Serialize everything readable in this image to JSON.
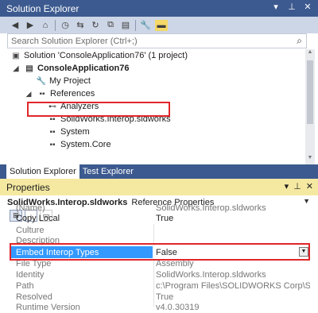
{
  "solution_explorer": {
    "title": "Solution Explorer",
    "search_placeholder": "Search Solution Explorer (Ctrl+;)",
    "tree": [
      {
        "label": "Solution 'ConsoleApplication76' (1 project)",
        "icon": "solution-icon",
        "bold": false
      },
      {
        "label": "ConsoleApplication76",
        "icon": "csharp-project-icon",
        "bold": true
      },
      {
        "label": "My Project",
        "icon": "wrench-icon",
        "bold": false
      },
      {
        "label": "References",
        "icon": "references-icon",
        "bold": false
      },
      {
        "label": "Analyzers",
        "icon": "analyzer-icon",
        "bold": false
      },
      {
        "label": "SolidWorks.Interop.sldworks",
        "icon": "reference-icon",
        "bold": false
      },
      {
        "label": "System",
        "icon": "reference-icon",
        "bold": false
      },
      {
        "label": "System.Core",
        "icon": "reference-icon",
        "bold": false
      }
    ],
    "tabs": [
      "Solution Explorer",
      "Test Explorer"
    ]
  },
  "properties": {
    "title": "Properties",
    "object_name": "SolidWorks.Interop.sldworks",
    "object_type": "Reference Properties",
    "rows": [
      {
        "name": "(Name)",
        "value": "SolidWorks.Interop.sldworks",
        "dark": false
      },
      {
        "name": "Copy Local",
        "value": "True",
        "dark": true
      },
      {
        "name": "Culture",
        "value": "",
        "dark": false
      },
      {
        "name": "Description",
        "value": "",
        "dark": false
      },
      {
        "name": "Embed Interop Types",
        "value": "False",
        "dark": true,
        "selected": true
      },
      {
        "name": "File Type",
        "value": "Assembly",
        "dark": false
      },
      {
        "name": "Identity",
        "value": "SolidWorks.Interop.sldworks",
        "dark": false
      },
      {
        "name": "Path",
        "value": "c:\\Program Files\\SOLIDWORKS Corp\\SOLIDWOR",
        "dark": false
      },
      {
        "name": "Resolved",
        "value": "True",
        "dark": false
      },
      {
        "name": "Runtime Version",
        "value": "v4.0.30319",
        "dark": false
      }
    ]
  },
  "colors": {
    "title_bar": "#3c5a8f",
    "properties_bar": "#f5e9a2",
    "selection": "#3399ff",
    "highlight_box": "#e0262b"
  }
}
